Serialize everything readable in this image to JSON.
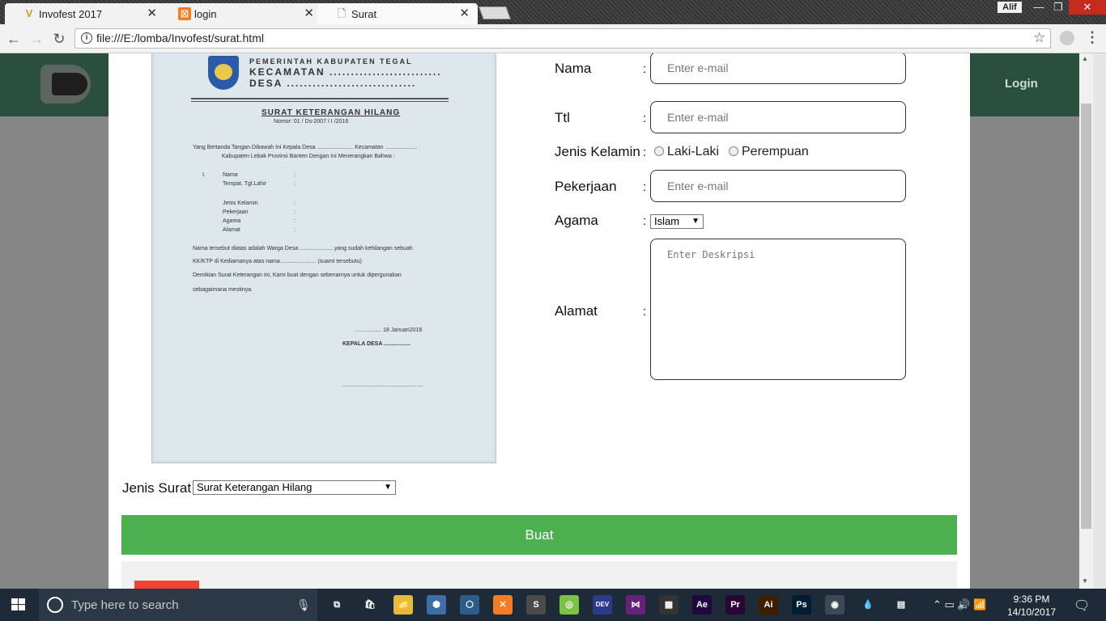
{
  "browser": {
    "tabs": [
      {
        "title": "Invofest 2017",
        "icon": "V"
      },
      {
        "title": "login",
        "icon": "⊠"
      },
      {
        "title": "Surat",
        "icon": "🗋"
      }
    ],
    "user_badge": "Alif",
    "url": "file:///E:/lomba/Invofest/surat.html"
  },
  "site": {
    "login_label": "Login"
  },
  "paper": {
    "header_line1": "PEMERINTAH KABUPATEN TEGAL",
    "header_line2": "KECAMATAN ..........................",
    "header_line3": "DESA ..............................",
    "title": "SURAT KETERANGAN HILANG",
    "nomor": "Nomor:      01 / Ds-2007 / I /2016",
    "intro1": "Yang Bertanda Tangan Dibawah Ini Kepala Desa ....................... Kecamatan ...................,",
    "intro2": "Kabupaten Lebak Provinsi Banten Dengan Ini Menerangkan Bahwa     :",
    "roman": "I.",
    "f_nama": "Nama",
    "f_ttl": "Tempat. Tgl.Lahir",
    "f_jk": "Jenis Kelamin",
    "f_pekerjaan": "Pekerjaan",
    "f_agama": "Agama",
    "f_alamat": "Alamat",
    "colon": ":",
    "body1": "Nama tersebut diatas adalah Warga Desa ......................yang sudah kehilangan sebuah",
    "body2": "KK/KTP di Kediamanya atas nama....................... (suami tersebutu)",
    "body3": "Demikian Surat Keterangan ini, Kami buat dengan sebenarnya untuk dipergunakan",
    "body4": "sebagaimana mestinya.",
    "date": "................. 18 Januari2016",
    "kepala": "KEPALA DESA .................",
    "signature": "..................................................."
  },
  "form": {
    "nama_label": "Nama",
    "ttl_label": "Ttl",
    "jk_label": "Jenis Kelamin",
    "pekerjaan_label": "Pekerjaan",
    "agama_label": "Agama",
    "alamat_label": "Alamat",
    "colon": ":",
    "email_placeholder": "Enter e-mail",
    "radio_male": "Laki-Laki",
    "radio_female": "Perempuan",
    "agama_value": "Islam",
    "alamat_placeholder": "Enter Deskripsi",
    "jenis_surat_label": "Jenis Surat",
    "jenis_surat_value": "Surat Keterangan Hilang",
    "submit_label": "Buat"
  },
  "taskbar": {
    "search_placeholder": "Type here to search",
    "time": "9:36 PM",
    "date": "14/10/2017",
    "apps": [
      {
        "icon": "task-view",
        "label": "⧉",
        "color": "transparent"
      },
      {
        "icon": "store",
        "label": "🛍",
        "color": "transparent"
      },
      {
        "icon": "file-explorer",
        "label": "📁",
        "color": "#e8b93a"
      },
      {
        "icon": "3d-box",
        "label": "⬢",
        "color": "#3d6ea8"
      },
      {
        "icon": "virtualbox",
        "label": "⬡",
        "color": "#2c5d8a"
      },
      {
        "icon": "xampp",
        "label": "✕",
        "color": "#f57c21"
      },
      {
        "icon": "sublime",
        "label": "S",
        "color": "#4b4b4b"
      },
      {
        "icon": "android-studio",
        "label": "◎",
        "color": "#7cc243"
      },
      {
        "icon": "dev-cpp",
        "label": "DEV",
        "color": "#2a3b8f"
      },
      {
        "icon": "visual-studio",
        "label": "⋈",
        "color": "#68217a"
      },
      {
        "icon": "media-player",
        "label": "▦",
        "color": "#333"
      },
      {
        "icon": "after-effects",
        "label": "Ae",
        "color": "#1f0740"
      },
      {
        "icon": "premiere",
        "label": "Pr",
        "color": "#2a0634"
      },
      {
        "icon": "illustrator",
        "label": "Ai",
        "color": "#3d1f00"
      },
      {
        "icon": "photoshop",
        "label": "Ps",
        "color": "#001d34"
      },
      {
        "icon": "chrome",
        "label": "◉",
        "color": "#3a4a56"
      },
      {
        "icon": "droplet",
        "label": "💧",
        "color": "transparent"
      },
      {
        "icon": "app-grid",
        "label": "▤",
        "color": "transparent"
      }
    ]
  },
  "colors": {
    "site_header": "#28503c",
    "submit": "#4caf50",
    "accent_red": "#f44336"
  }
}
